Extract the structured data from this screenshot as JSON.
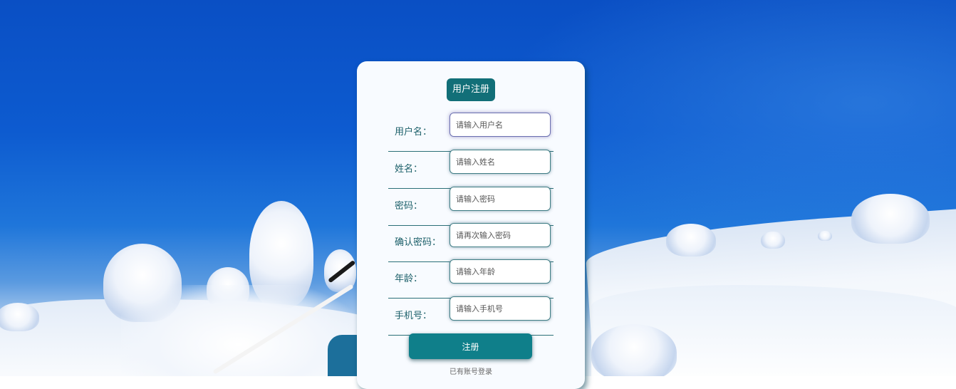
{
  "register": {
    "title": "用户注册",
    "fields": [
      {
        "label": "用户名：",
        "placeholder": "请输入用户名"
      },
      {
        "label": "姓名：",
        "placeholder": "请输入姓名"
      },
      {
        "label": "密码：",
        "placeholder": "请输入密码"
      },
      {
        "label": "确认密码：",
        "placeholder": "请再次输入密码"
      },
      {
        "label": "年龄：",
        "placeholder": "请输入年龄"
      },
      {
        "label": "手机号：",
        "placeholder": "请输入手机号"
      }
    ],
    "submit_label": "注册",
    "login_link": "已有账号登录"
  },
  "colors": {
    "accent": "#126f78",
    "button": "#0f7f8a",
    "card_bg": "#f8fbff",
    "sky": "#0a4fc4"
  }
}
